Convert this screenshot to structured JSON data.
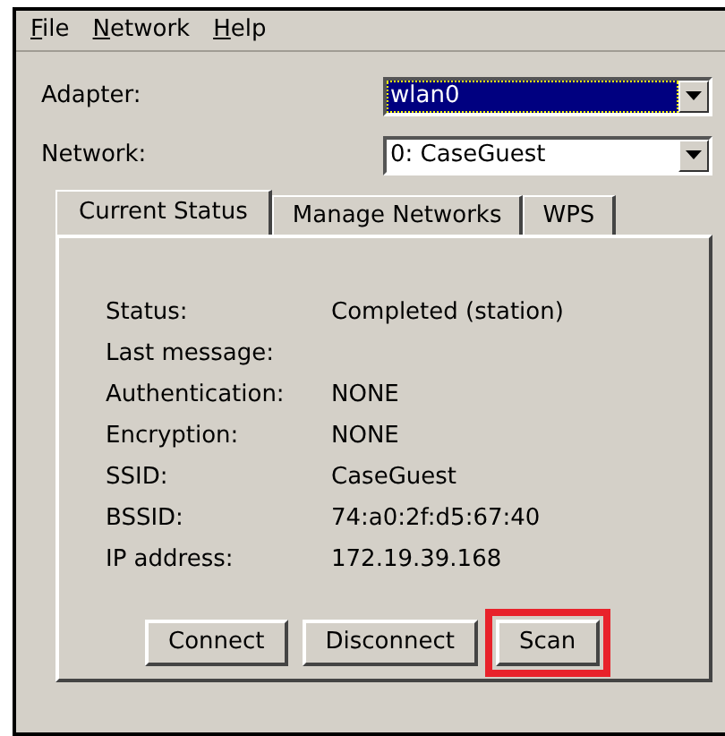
{
  "menu": [
    {
      "label": "File"
    },
    {
      "label": "Network"
    },
    {
      "label": "Help"
    }
  ],
  "fields": [
    {
      "label": "Adapter:",
      "value": "wlan0",
      "focused": true
    },
    {
      "label": "Network:",
      "value": "0: CaseGuest",
      "focused": false
    }
  ],
  "tabs": [
    {
      "label": "Current Status",
      "selected": true
    },
    {
      "label": "Manage Networks",
      "selected": false
    },
    {
      "label": "WPS",
      "selected": false
    }
  ],
  "status": [
    {
      "label": "Status:",
      "value": "Completed (station)"
    },
    {
      "label": "Last message:"
    },
    {
      "label": "Authentication:",
      "value": "NONE"
    },
    {
      "label": "Encryption:",
      "value": "NONE"
    },
    {
      "label": "SSID:",
      "value": "CaseGuest"
    },
    {
      "label": "BSSID:",
      "value": "74:a0:2f:d5:67:40"
    },
    {
      "label": "IP address:",
      "value": "172.19.39.168"
    }
  ],
  "buttons": [
    {
      "label": "Connect",
      "highlighted": false
    },
    {
      "label": "Disconnect",
      "highlighted": false
    },
    {
      "label": "Scan",
      "highlighted": true
    }
  ]
}
